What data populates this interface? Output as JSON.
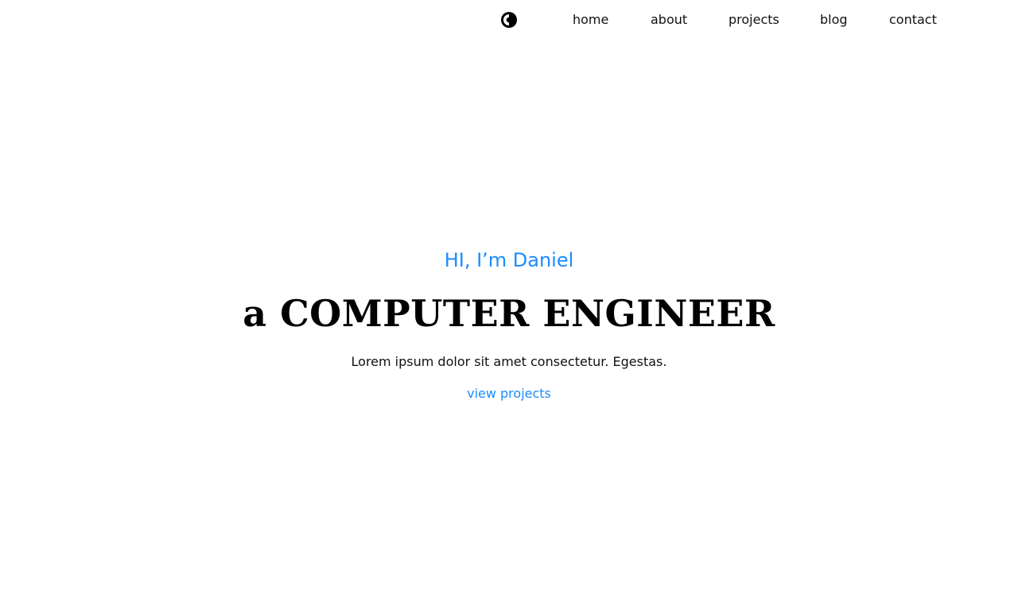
{
  "colors": {
    "accent": "#1a8cff",
    "text": "#111111",
    "heading": "#000000",
    "background": "#ffffff"
  },
  "header": {
    "theme_toggle_icon": "contrast-half-circle-icon",
    "nav": [
      {
        "label": "home"
      },
      {
        "label": "about"
      },
      {
        "label": "projects"
      },
      {
        "label": "blog"
      },
      {
        "label": "contact"
      }
    ]
  },
  "hero": {
    "greeting": "HI, I’m Daniel",
    "title": "a COMPUTER ENGINEER",
    "description": "Lorem ipsum dolor sit amet consectetur. Egestas.",
    "cta_label": "view projects"
  }
}
